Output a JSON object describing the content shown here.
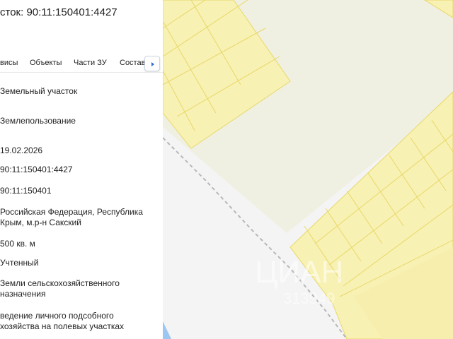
{
  "panel": {
    "title": "сток: 90:11:150401:4427",
    "tabs": [
      "висы",
      "Объекты",
      "Части ЗУ",
      "Состав"
    ],
    "fields": [
      "Земельный участок",
      "Землепользование",
      "19.02.2026",
      "90:11:150401:4427",
      "90:11:150401",
      "Российская Федерация, Республика Крым, м.р-н Сакский",
      "500 кв. м",
      "Учтенный",
      "Земли сельскохозяйственного назначения",
      "ведение личного подсобного хозяйства на полевых участках"
    ]
  },
  "map": {
    "watermark": "ЦИАН",
    "watermark_id": "313949",
    "colors": {
      "parcel_fill": "#f8f1b4",
      "parcel_stroke": "#e8d868",
      "background_area": "#f0f0e2",
      "road": "#f4f4f4",
      "water": "#9cc7f0"
    }
  }
}
